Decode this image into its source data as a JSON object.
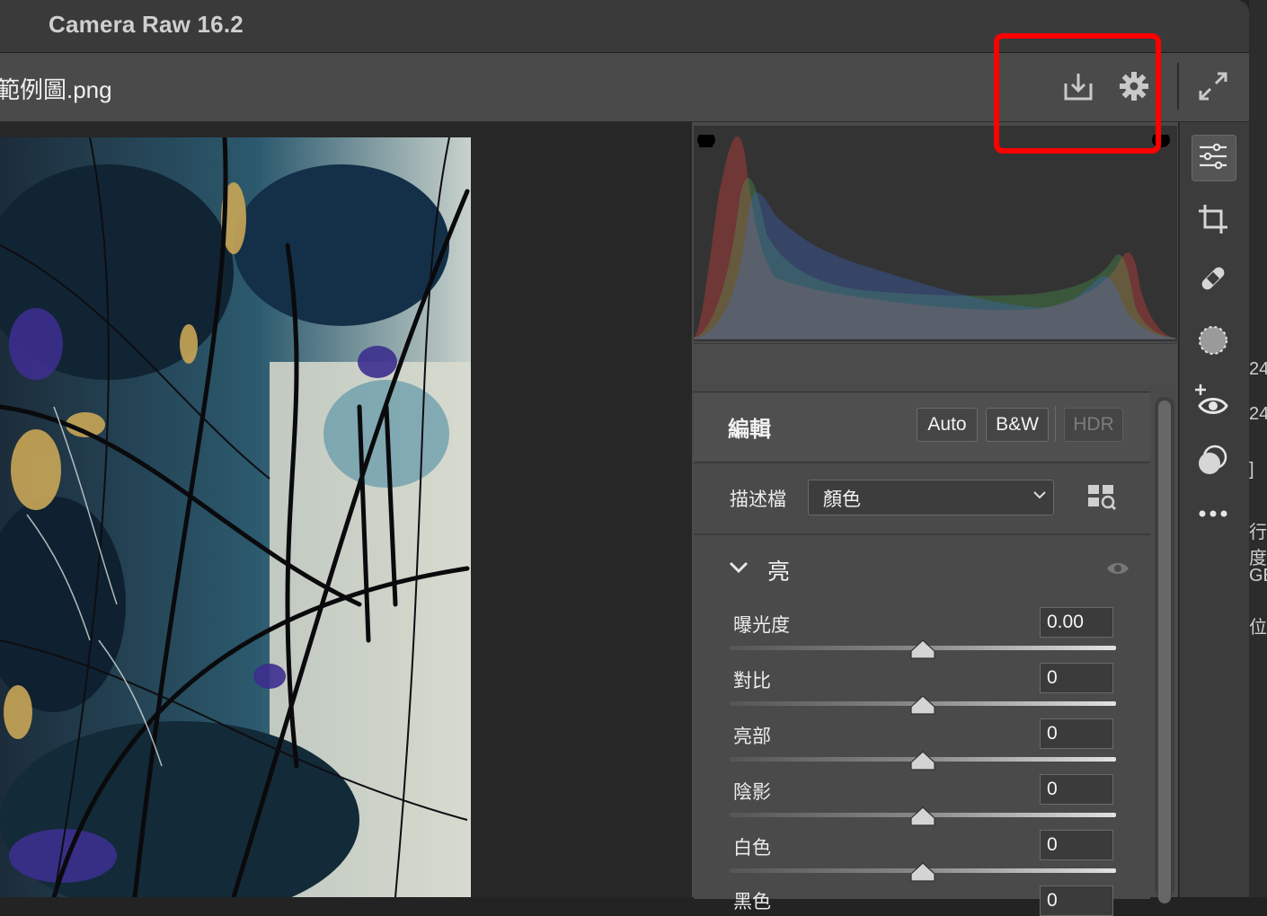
{
  "app": {
    "title": "Camera Raw 16.2"
  },
  "file": {
    "name": "範例圖.png"
  },
  "toolbar": {
    "icons": [
      "save-download-icon",
      "settings-gear-icon",
      "fullscreen-icon"
    ],
    "highlight_color": "#ff0000"
  },
  "edit": {
    "title": "編輯",
    "buttons": {
      "auto": "Auto",
      "bw": "B&W",
      "hdr": "HDR"
    }
  },
  "profile": {
    "label": "描述檔",
    "value": "顏色"
  },
  "light": {
    "title": "亮",
    "sliders": [
      {
        "label": "曝光度",
        "value": "0.00"
      },
      {
        "label": "對比",
        "value": "0"
      },
      {
        "label": "亮部",
        "value": "0"
      },
      {
        "label": "陰影",
        "value": "0"
      },
      {
        "label": "白色",
        "value": "0"
      },
      {
        "label": "黑色",
        "value": "0"
      }
    ]
  },
  "side_tools": [
    "edit-sliders-icon",
    "crop-icon",
    "healing-bandage-icon",
    "masking-icon",
    "red-eye-icon",
    "presets-icon",
    "more-icon"
  ],
  "far_right_fragments": [
    "24",
    "24",
    "]",
    "行度",
    "GE",
    "位"
  ],
  "colors": {
    "histogram_red": "#e0413b",
    "histogram_green": "#4fc25a",
    "histogram_blue": "#3f6bd8"
  }
}
